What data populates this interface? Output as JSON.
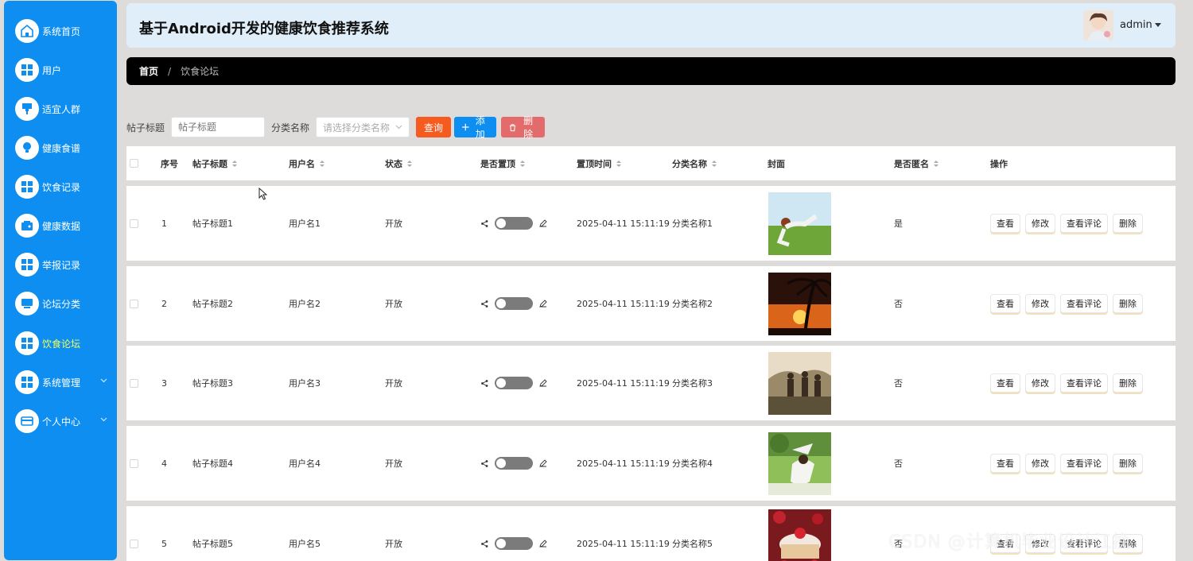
{
  "sidebar": {
    "items": [
      {
        "label": "系统首页",
        "icon": "home-icon"
      },
      {
        "label": "用户",
        "icon": "grid-icon"
      },
      {
        "label": "适宜人群",
        "icon": "brush-icon"
      },
      {
        "label": "健康食谱",
        "icon": "bulb-icon"
      },
      {
        "label": "饮食记录",
        "icon": "grid-icon"
      },
      {
        "label": "健康数据",
        "icon": "wallet-icon"
      },
      {
        "label": "举报记录",
        "icon": "grid-icon"
      },
      {
        "label": "论坛分类",
        "icon": "monitor-icon"
      },
      {
        "label": "饮食论坛",
        "icon": "grid-icon",
        "active": true
      },
      {
        "label": "系统管理",
        "icon": "grid-icon",
        "expandable": true
      },
      {
        "label": "个人中心",
        "icon": "card-icon",
        "expandable": true
      }
    ]
  },
  "header": {
    "title": "基于Android开发的健康饮食推荐系统",
    "username": "admin"
  },
  "breadcrumb": {
    "home": "首页",
    "separator": "/",
    "current": "饮食论坛"
  },
  "search": {
    "title_label": "帖子标题",
    "title_placeholder": "帖子标题",
    "category_label": "分类名称",
    "category_placeholder": "请选择分类名称",
    "query_button": "查询",
    "add_button": "添加",
    "delete_button": "删除"
  },
  "table": {
    "columns": [
      "序号",
      "帖子标题",
      "用户名",
      "状态",
      "是否置顶",
      "置顶时间",
      "分类名称",
      "封面",
      "是否匿名",
      "操作"
    ],
    "rows": [
      {
        "index": "1",
        "title": "帖子标题1",
        "user": "用户名1",
        "status": "开放",
        "pinned_time": "2025-04-11 15:11:19",
        "category": "分类名称1",
        "anonymous": "是"
      },
      {
        "index": "2",
        "title": "帖子标题2",
        "user": "用户名2",
        "status": "开放",
        "pinned_time": "2025-04-11 15:11:19",
        "category": "分类名称2",
        "anonymous": "否"
      },
      {
        "index": "3",
        "title": "帖子标题3",
        "user": "用户名3",
        "status": "开放",
        "pinned_time": "2025-04-11 15:11:19",
        "category": "分类名称3",
        "anonymous": "否"
      },
      {
        "index": "4",
        "title": "帖子标题4",
        "user": "用户名4",
        "status": "开放",
        "pinned_time": "2025-04-11 15:11:19",
        "category": "分类名称4",
        "anonymous": "否"
      },
      {
        "index": "5",
        "title": "帖子标题5",
        "user": "用户名5",
        "status": "开放",
        "pinned_time": "2025-04-11 15:11:19",
        "category": "分类名称5",
        "anonymous": "否"
      }
    ],
    "actions": {
      "view": "查看",
      "edit": "修改",
      "view_comments": "查看评论",
      "delete": "删除"
    }
  },
  "watermark": "CSDN @计算机毕业设计江挽",
  "colors": {
    "sidebar": "#0d8ef0",
    "active_menu": "#f4ff5a",
    "query": "#f55a1e",
    "add": "#0d8ef0",
    "delete": "#e46b6b"
  }
}
